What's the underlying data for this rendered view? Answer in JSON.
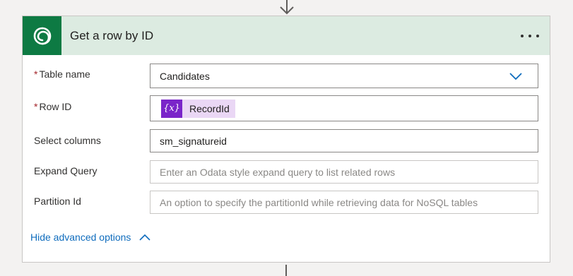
{
  "card": {
    "title": "Get a row by ID",
    "icon": "dataverse-icon",
    "header_color": "#dcebe1",
    "icon_bg": "#0d7a43"
  },
  "fields": {
    "table_name": {
      "label": "Table name",
      "required": "*",
      "value": "Candidates"
    },
    "row_id": {
      "label": "Row ID",
      "required": "*",
      "token_symbol": "{x}",
      "token_label": "RecordId"
    },
    "select_columns": {
      "label": "Select columns",
      "value": "sm_signatureid"
    },
    "expand_query": {
      "label": "Expand Query",
      "placeholder": "Enter an Odata style expand query to list related rows"
    },
    "partition_id": {
      "label": "Partition Id",
      "placeholder": "An option to specify the partitionId while retrieving data for NoSQL tables"
    }
  },
  "advanced": {
    "label": "Hide advanced options",
    "link_color": "#0f6cbd"
  }
}
